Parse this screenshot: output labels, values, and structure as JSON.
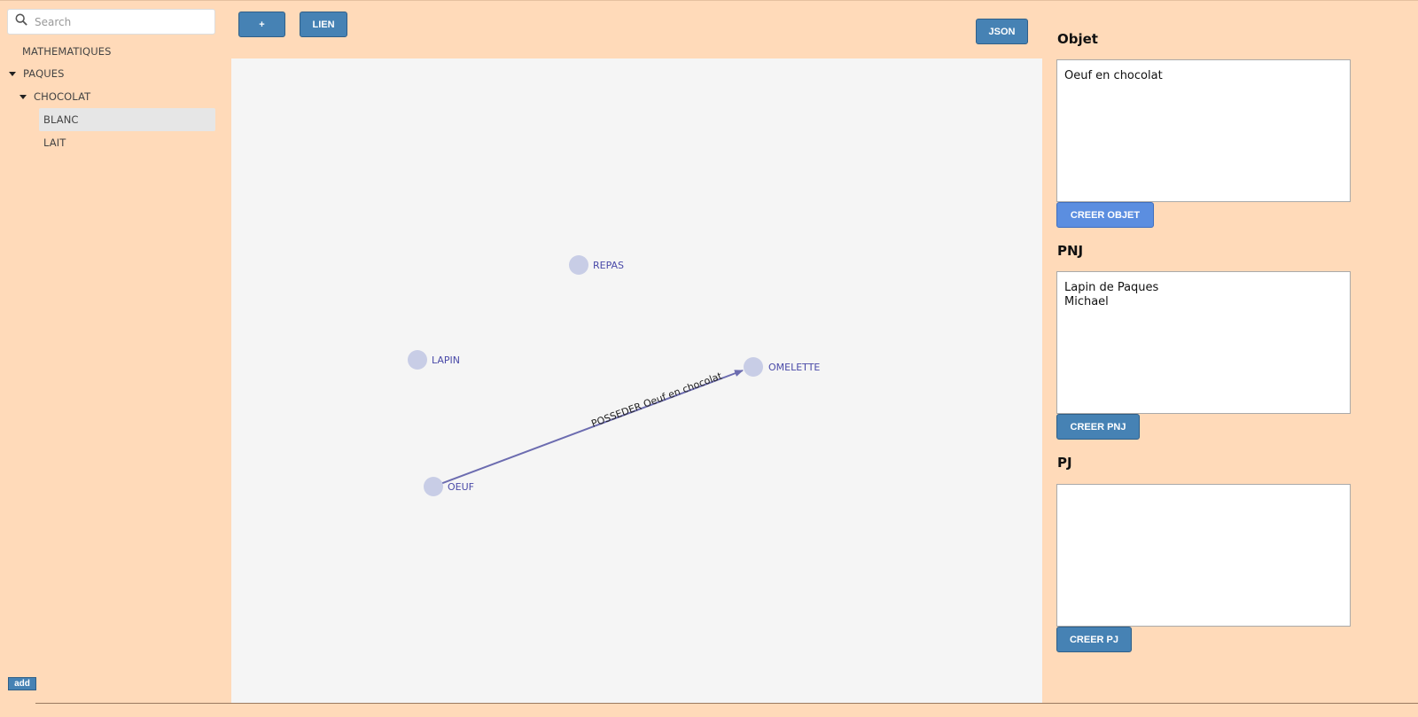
{
  "sidebar": {
    "search_placeholder": "Search",
    "tree": [
      {
        "label": "MATHEMATIQUES",
        "expanded": false,
        "selected": false
      },
      {
        "label": "PAQUES",
        "expanded": true,
        "selected": false
      },
      {
        "label": "CHOCOLAT",
        "expanded": true,
        "selected": false
      },
      {
        "label": "BLANC",
        "expanded": false,
        "selected": true
      },
      {
        "label": "LAIT",
        "expanded": false,
        "selected": false
      }
    ],
    "add_label": "add"
  },
  "toolbar": {
    "plus_label": "+",
    "lien_label": "LIEN",
    "json_label": "JSON"
  },
  "graph": {
    "nodes": {
      "repas": "REPAS",
      "lapin": "LAPIN",
      "omelette": "OMELETTE",
      "oeuf": "OEUF"
    },
    "edge_label": "POSSEDER Oeuf en chocolat"
  },
  "panels": {
    "objet": {
      "title": "Objet",
      "value": "Oeuf en chocolat",
      "button": "CREER OBJET"
    },
    "pnj": {
      "title": "PNJ",
      "value": "Lapin de Paques\nMichael",
      "button": "CREER PNJ"
    },
    "pj": {
      "title": "PJ",
      "value": "",
      "button": "CREER PJ"
    }
  },
  "colors": {
    "background": "#ffdab9",
    "button": "#4682b4",
    "node": "#c8cde6",
    "edge": "#6c6cb0"
  }
}
